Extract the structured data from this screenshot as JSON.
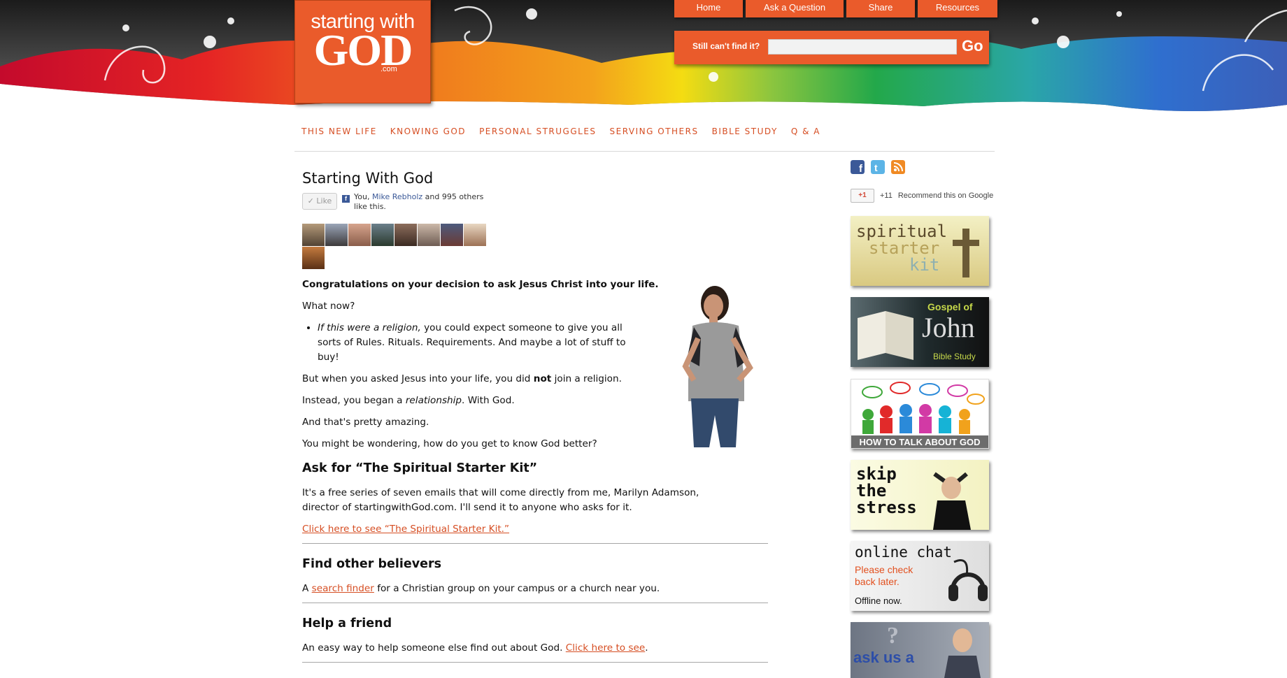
{
  "header": {
    "logo": {
      "line1": "starting with",
      "line2": "GOD",
      "line3": ".com"
    },
    "nav": [
      "Home",
      "Ask a Question",
      "Share",
      "Resources"
    ],
    "search": {
      "label": "Still can't find it?",
      "placeholder": "",
      "button": "Go"
    }
  },
  "main_nav": [
    "THIS NEW LIFE",
    "KNOWING GOD",
    "PERSONAL STRUGGLES",
    "SERVING OTHERS",
    "BIBLE STUDY",
    "Q & A"
  ],
  "article": {
    "title": "Starting With God",
    "like": {
      "button": "Like",
      "you": "You, ",
      "friend": "Mike Rebholz",
      "rest": " and 995 others like this."
    },
    "intro": "Congratulations on your decision to ask Jesus Christ into your life.",
    "what_now": "What now?",
    "bullet_em": "If this were a religion,",
    "bullet_rest": " you could expect someone to give you all sorts of Rules. Rituals. Requirements. And maybe a lot of stuff to buy!",
    "p_but_a": "But when you asked Jesus into your life, you did ",
    "p_but_b": "not",
    "p_but_c": " join a religion.",
    "p_instead_a": "Instead, you began a ",
    "p_instead_b": "relationship",
    "p_instead_c": ". With God.",
    "p_amazing": "And that's pretty amazing.",
    "p_wondering": "You might be wondering, how do you get to know God better?",
    "h_starter": "Ask for “The Spiritual Starter Kit”",
    "p_starter": "It's a free series of seven emails that will come directly from me, Marilyn Adamson, director of startingwithGod.com. I'll send it to anyone who asks for it.",
    "link_starter": "Click here to see “The Spiritual Starter Kit.”",
    "h_believers": "Find other believers",
    "p_believers_a": "A ",
    "link_finder": "search finder",
    "p_believers_b": " for a Christian group on your campus or a church near you.",
    "h_friend": "Help a friend",
    "p_friend_a": "An easy way to help someone else find out about God. ",
    "link_friend": "Click here to see",
    "p_friend_b": "."
  },
  "sidebar": {
    "social_icons": [
      "facebook-icon",
      "twitter-icon",
      "rss-icon"
    ],
    "gplus": {
      "button": "+1",
      "count": "+11",
      "text": "Recommend this on Google"
    },
    "banners": {
      "starter": {
        "l1": "spiritual",
        "l2": "starter",
        "l3": "kit"
      },
      "john": {
        "l1": "Gospel of",
        "l2": "John",
        "l3": "Bible Study"
      },
      "talk": {
        "caption": "HOW TO TALK ABOUT GOD"
      },
      "stress": {
        "l1": "skip",
        "l2": "the",
        "l3": "stress"
      },
      "chat": {
        "title": "online chat",
        "l1": "Please check",
        "l2": "back later.",
        "status": "Offline now."
      },
      "ask": {
        "text": "ask us a"
      }
    }
  },
  "colors": {
    "accent": "#ea5b2b",
    "link": "#d64e23",
    "facebook": "#3b5998"
  }
}
